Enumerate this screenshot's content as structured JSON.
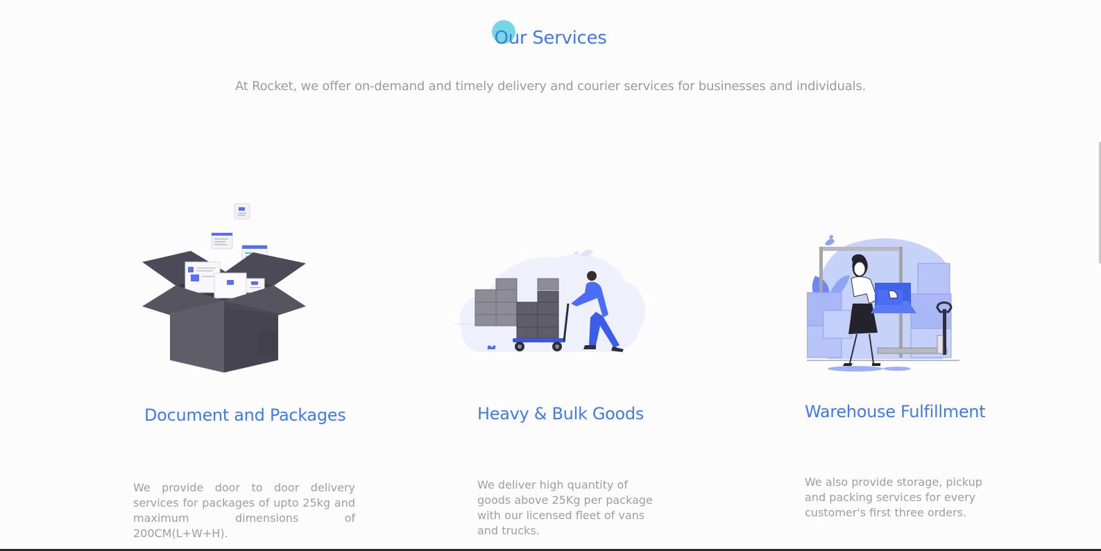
{
  "section": {
    "title": "Our Services",
    "subtitle": "At Rocket, we offer on-demand and timely delivery and courier services for businesses and individuals."
  },
  "services": [
    {
      "title": "Document and Packages",
      "description": "We provide door to door delivery services for packages of upto 25kg and maximum dimensions of 200CM(L+W+H).",
      "illustration": "open-box-documents-icon"
    },
    {
      "title": "Heavy & Bulk Goods",
      "description": "We deliver high quantity of goods above 25Kg per package with our licensed fleet of vans and trucks.",
      "illustration": "worker-pushing-cart-icon"
    },
    {
      "title": "Warehouse Fulfillment",
      "description": "We also provide storage, pickup and packing services for every customer's first three orders.",
      "illustration": "woman-carrying-box-icon"
    }
  ],
  "colors": {
    "accent": "#3d7be8",
    "body_text": "#9d9da2",
    "illustration_blue": "#4a6cf7",
    "illustration_dark": "#4e4d58",
    "cursor_highlight": "#5fd0dc"
  }
}
